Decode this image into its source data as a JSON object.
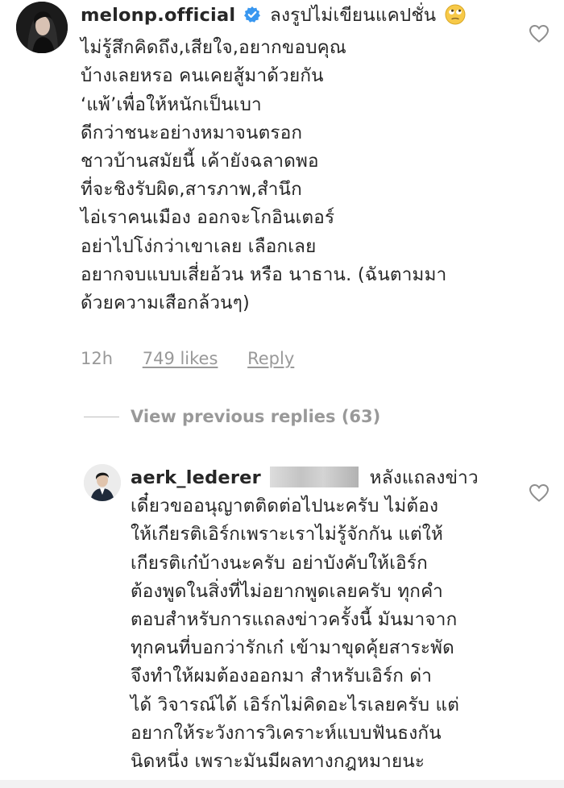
{
  "comments": [
    {
      "username": "melonp.official",
      "first_line_text": "ลงรูปไม่เขียนแคปชั่น",
      "lines": [
        "ไม่รู้สึกคิดถึง,เสียใจ,อยากขอบคุณ",
        "บ้างเลยหรอ คนเคยสู้มาด้วยกัน",
        "‘แพ้’เพื่อให้หนักเป็นเบา",
        "ดีกว่าชนะอย่างหมาจนตรอก",
        "ชาวบ้านสมัยนี้ เค้ายังฉลาดพอ",
        "ที่จะชิงรับผิด,สารภาพ,สำนึก",
        "ไอ่เราคนเมือง ออกจะโกอินเตอร์",
        "อย่าไปโง่กว่าเขาเลย เลือกเลย",
        "อยากจบแบบเสี่ยอ้วน หรือ นาธาน. (ฉันตามมา",
        "ด้วยความเสือกล้วนๆ)"
      ],
      "time": "12h",
      "likes": "749 likes",
      "reply": "Reply"
    },
    {
      "username": "aerk_lederer",
      "first_line_text": "หลังแถลงข่าว",
      "lines": [
        "เดี๋ยวขออนุญาตติดต่อไปนะครับ ไม่ต้อง",
        "ให้เกียรติเอิร์กเพราะเราไม่รู้จักกัน แต่ให้",
        "เกียรติเก๋บ้างนะครับ อย่าบังคับให้เอิร์ก",
        "ต้องพูดในสิ่งที่ไม่อยากพูดเลยครับ ทุกคำ",
        "ตอบสำหรับการแถลงข่าวครั้งนี้ มันมาจาก",
        "ทุกคนที่บอกว่ารักเก๋ เข้ามาขุดคุ้ยสาระพัด",
        "จึงทำให้ผมต้องออกมา สำหรับเอิร์ก ด่า",
        "ได้ วิจารณ์ได้ เอิร์กไม่คิดอะไรเลยครับ แต่",
        "อยากให้ระวังการวิเคราะห์แบบฟันธงกัน",
        "นิดหนึ่ง เพราะมันมีผลทางกฎหมายนะ"
      ]
    }
  ],
  "view_previous": "View previous replies (63)",
  "icons": {
    "verified": "verified-badge-icon",
    "emoji": "eye-roll-emoji-icon",
    "like": "heart-outline-icon"
  },
  "colors": {
    "text": "#262626",
    "muted": "#999999",
    "verified": "#3897f0"
  }
}
